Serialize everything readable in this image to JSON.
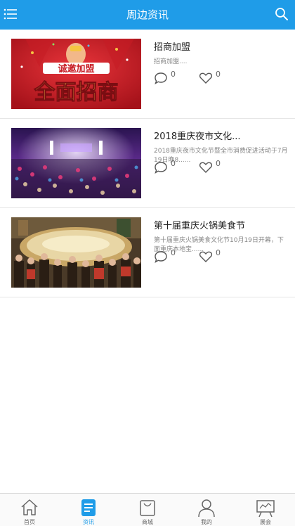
{
  "header": {
    "title": "周边资讯",
    "menu_icon": "list-menu-icon",
    "search_icon": "search-icon",
    "color": "#1f9ce8"
  },
  "articles": [
    {
      "title": "招商加盟",
      "summary": "招商加盟....",
      "comments": "0",
      "likes": "0",
      "image_banner": "诚邀加盟",
      "image_headline": "全面招商"
    },
    {
      "title": "2018重庆夜市文化...",
      "summary": "2018重庆夜市文化节暨全市消费促进活动于7月19日晚8......",
      "comments": "0",
      "likes": "0"
    },
    {
      "title": "第十届重庆火锅美食节",
      "summary": "第十届重庆火锅美食文化节10月19日开幕，下面重庆本地宝......",
      "comments": "0",
      "likes": "0"
    }
  ],
  "tabbar": {
    "items": [
      {
        "label": "首页",
        "icon": "home-icon"
      },
      {
        "label": "资讯",
        "icon": "news-icon",
        "active": true
      },
      {
        "label": "商城",
        "icon": "shopping-bag-icon"
      },
      {
        "label": "我的",
        "icon": "user-icon"
      },
      {
        "label": "展会",
        "icon": "exhibition-board-icon"
      }
    ],
    "active_color": "#1f9ce8"
  }
}
